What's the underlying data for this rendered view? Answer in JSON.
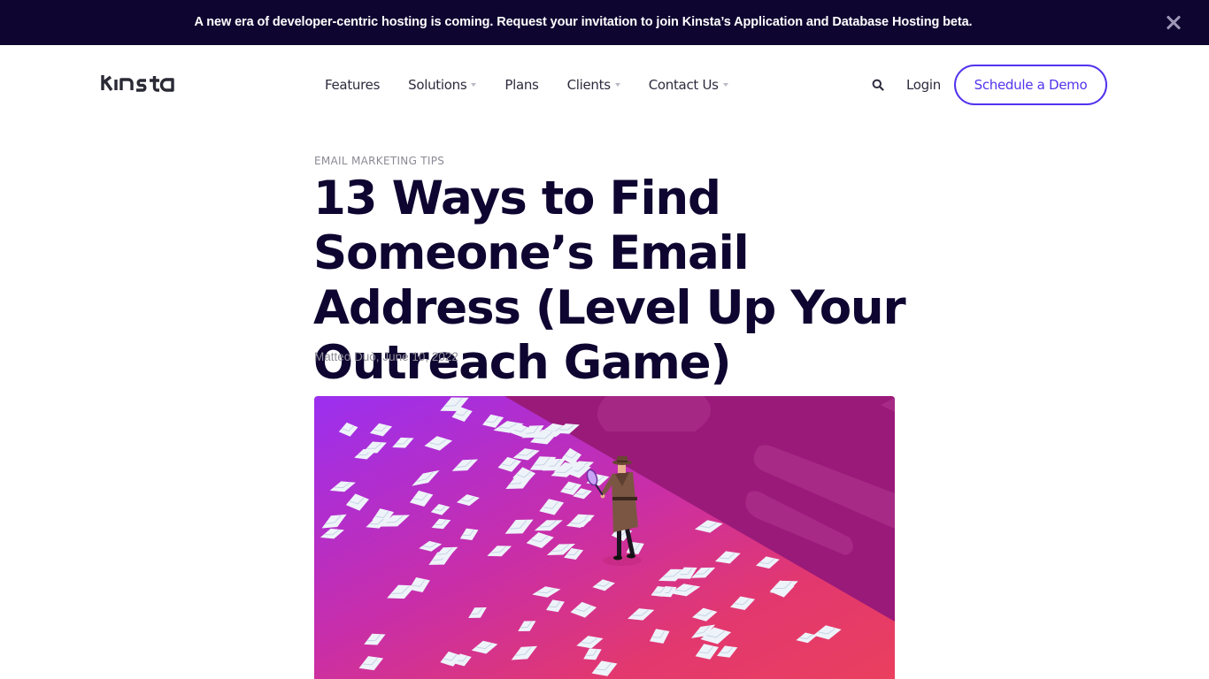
{
  "banner": {
    "text": "A new era of developer-centric hosting is coming. Request your invitation to join Kinsta’s Application and Database Hosting beta.",
    "close_icon": "close-icon"
  },
  "header": {
    "logo": "KINSTa",
    "nav": [
      {
        "label": "Features",
        "has_dropdown": false
      },
      {
        "label": "Solutions",
        "has_dropdown": true
      },
      {
        "label": "Plans",
        "has_dropdown": false
      },
      {
        "label": "Clients",
        "has_dropdown": true
      },
      {
        "label": "Contact Us",
        "has_dropdown": true
      }
    ],
    "search_icon": "search-icon",
    "login_label": "Login",
    "demo_label": "Schedule a Demo"
  },
  "article": {
    "category": "EMAIL MARKETING TIPS",
    "title": "13 Ways to Find Someone’s Email Address (Level Up Your Outreach Game)",
    "author": "Matteo Duò",
    "date": "June 10, 2022",
    "hero_image": "detective-with-magnifying-glass-among-envelopes-illustration"
  },
  "colors": {
    "banner_bg": "#0e0530",
    "accent": "#5333ed",
    "title": "#0e0530",
    "hero_purple": "#9b2ff0",
    "hero_pink": "#e83f63",
    "hero_dark": "#9a1a7a"
  }
}
